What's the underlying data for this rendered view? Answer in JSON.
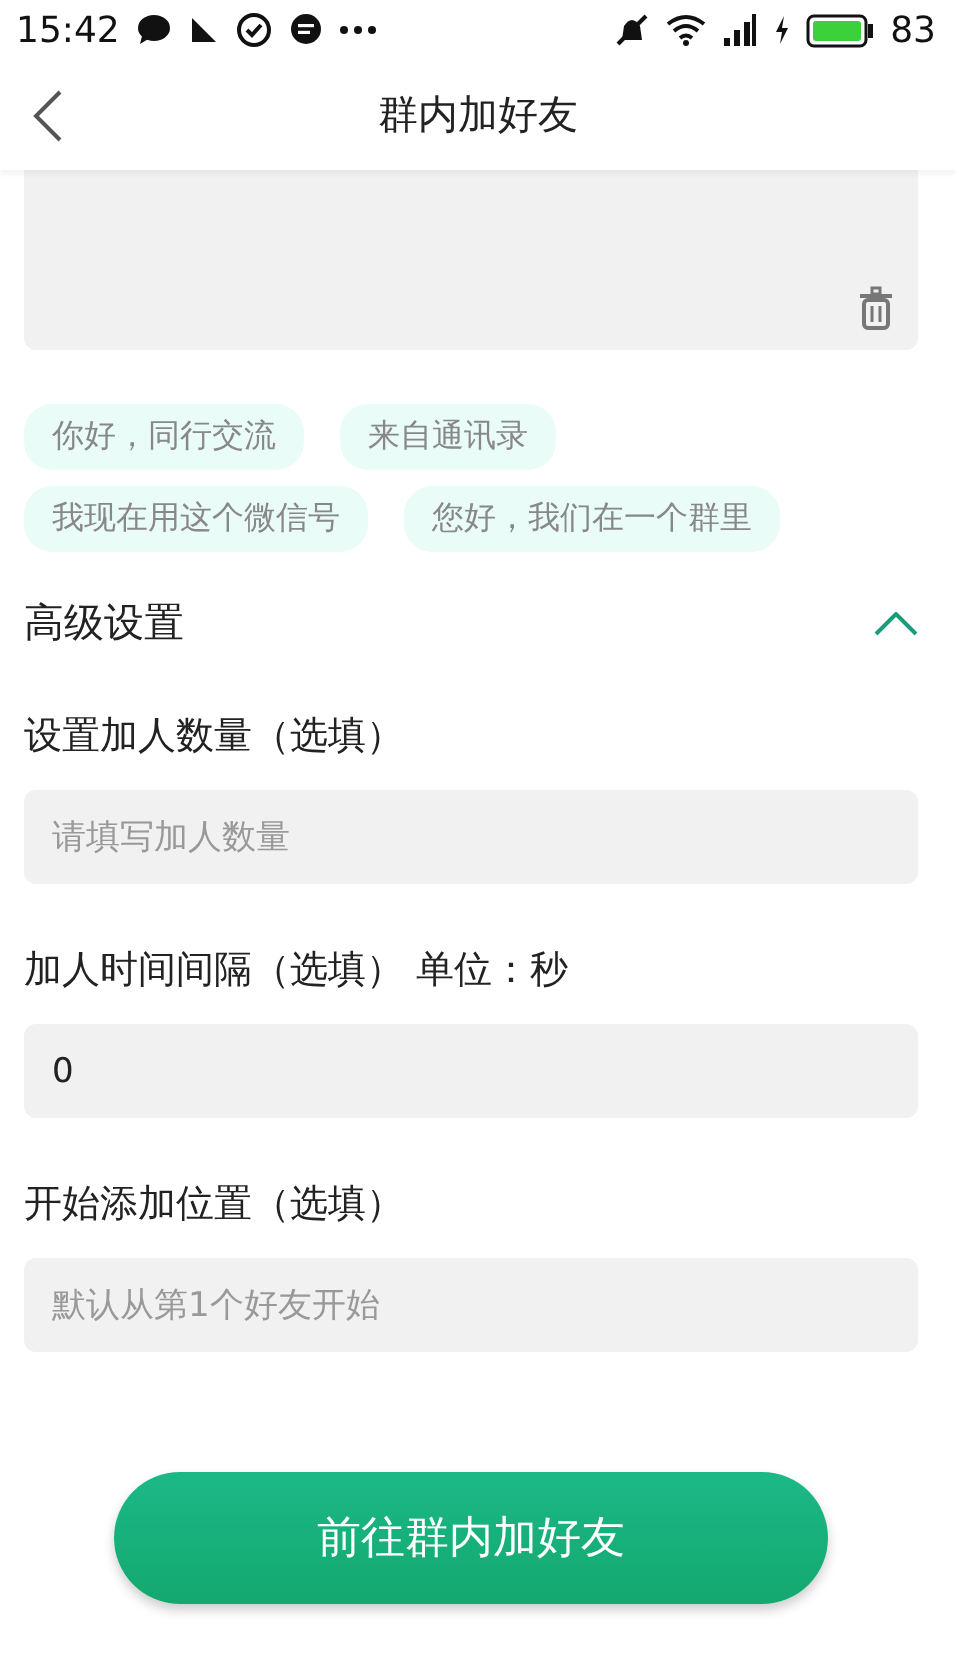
{
  "status_bar": {
    "time": "15:42",
    "battery": "83"
  },
  "header": {
    "title": "群内加好友"
  },
  "tags": [
    {
      "label": "你好，同行交流"
    },
    {
      "label": "来自通讯录"
    },
    {
      "label": "我现在用这个微信号"
    },
    {
      "label": "您好，我们在一个群里"
    }
  ],
  "advanced": {
    "title": "高级设置",
    "expanded": true
  },
  "fields": [
    {
      "label": "设置加人数量（选填）",
      "placeholder": "请填写加人数量"
    },
    {
      "label": "加人时间间隔（选填） 单位：秒",
      "value": "0"
    },
    {
      "label": "开始添加位置（选填）",
      "placeholder": "默认从第1个好友开始"
    }
  ],
  "submit": {
    "label": "前往群内加好友"
  }
}
